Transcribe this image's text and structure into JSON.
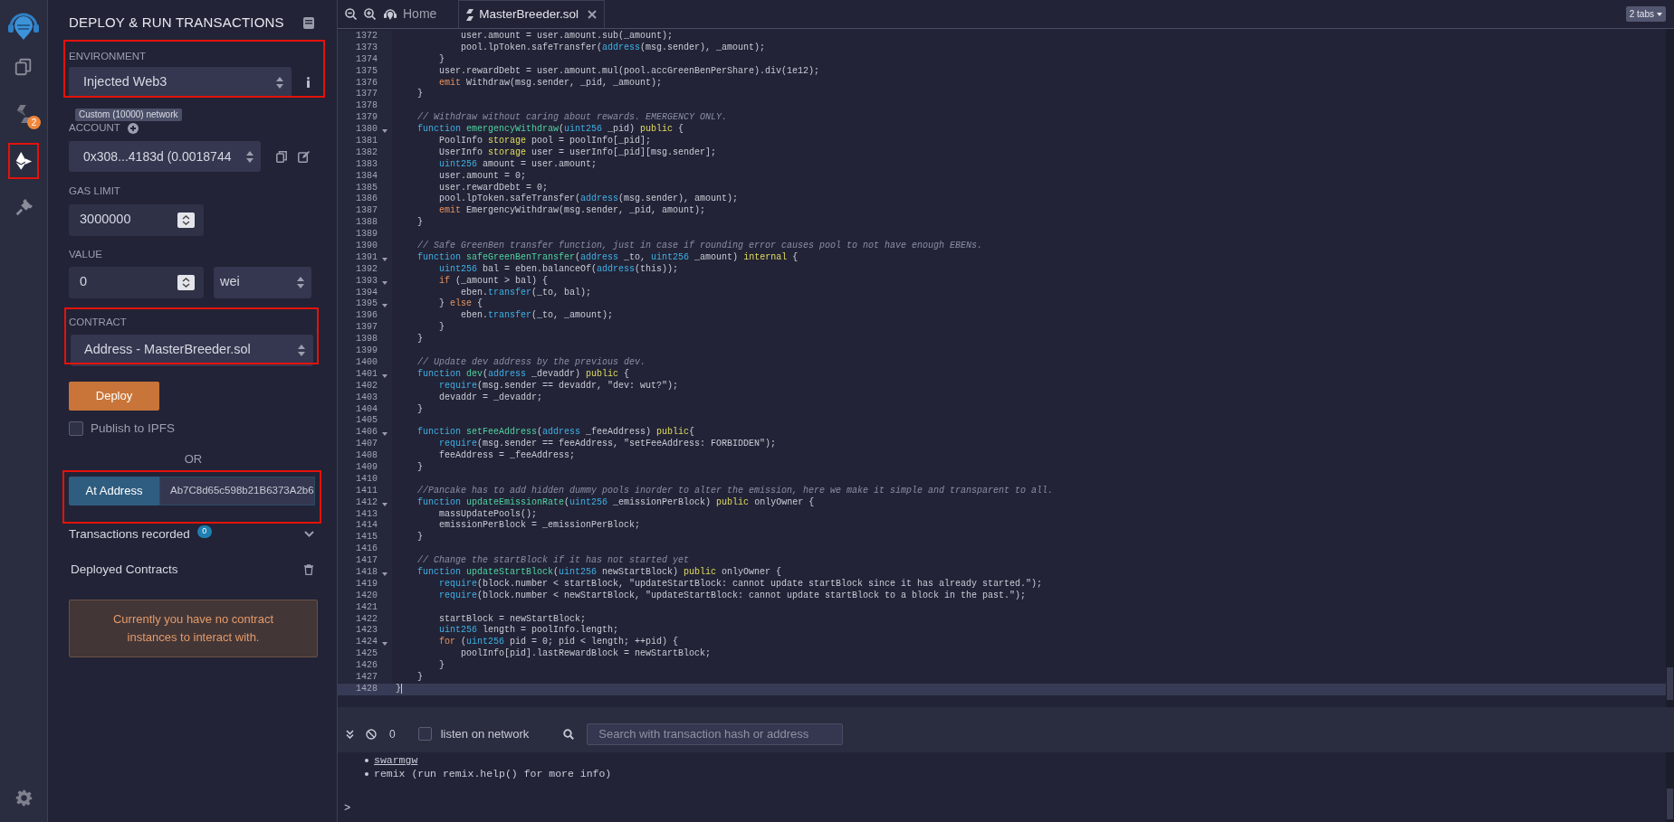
{
  "icon_bar": {
    "items": [
      {
        "kind": "files",
        "selected": false
      },
      {
        "kind": "compiler",
        "selected": false,
        "badge": "2"
      },
      {
        "kind": "deploy",
        "selected": true
      },
      {
        "kind": "plugins",
        "selected": false
      }
    ]
  },
  "panel": {
    "title": "DEPLOY & RUN TRANSACTIONS",
    "environment": {
      "label": "ENVIRONMENT",
      "value": "Injected Web3",
      "tooltip": "Custom (10000) network"
    },
    "account": {
      "label": "ACCOUNT",
      "value": "0x308...4183d (0.0018744"
    },
    "gas_limit": {
      "label": "GAS LIMIT",
      "value": "3000000"
    },
    "value": {
      "label": "VALUE",
      "value": "0",
      "unit": "wei"
    },
    "contract": {
      "label": "CONTRACT",
      "value": "Address - MasterBreeder.sol"
    },
    "deploy_button": "Deploy",
    "publish": {
      "label": "Publish to IPFS",
      "checked": false
    },
    "or": "OR",
    "at_address": {
      "button": "At Address",
      "value": "Ab7C8d65c598b21B6373A2b6"
    },
    "transactions": {
      "label": "Transactions recorded",
      "count": "0"
    },
    "deployed": {
      "label": "Deployed Contracts"
    },
    "message": "Currently you have no contract instances to interact with."
  },
  "editor": {
    "tabs": [
      {
        "kind": "home",
        "label": "Home",
        "selected": false
      },
      {
        "kind": "file",
        "label": "MasterBreeder.sol",
        "selected": true
      }
    ],
    "tabs_menu": "2 tabs",
    "lines": [
      {
        "n": "1372",
        "foldable": false,
        "active": false,
        "t": [
          {
            "kind": "p",
            "text": "            user.amount = user.amount.sub(_amount);"
          }
        ]
      },
      {
        "n": "1373",
        "foldable": false,
        "active": false,
        "t": [
          {
            "kind": "p",
            "text": "            pool.lpToken.safeTransfer("
          },
          {
            "kind": "kw",
            "text": "address"
          },
          {
            "kind": "p",
            "text": "(msg.sender), _amount);"
          }
        ]
      },
      {
        "n": "1374",
        "foldable": false,
        "active": false,
        "t": [
          {
            "kind": "p",
            "text": "        }"
          }
        ]
      },
      {
        "n": "1375",
        "foldable": false,
        "active": false,
        "t": [
          {
            "kind": "p",
            "text": "        user.rewardDebt = user.amount.mul(pool.accGreenBenPerShare).div(1e12);"
          }
        ]
      },
      {
        "n": "1376",
        "foldable": false,
        "active": false,
        "t": [
          {
            "kind": "ctl",
            "text": "        emit"
          },
          {
            "kind": "p",
            "text": " Withdraw(msg.sender, _pid, _amount);"
          }
        ]
      },
      {
        "n": "1377",
        "foldable": false,
        "active": false,
        "t": [
          {
            "kind": "p",
            "text": "    }"
          }
        ]
      },
      {
        "n": "1378",
        "foldable": false,
        "active": false
      },
      {
        "n": "1379",
        "foldable": false,
        "active": false,
        "t": [
          {
            "kind": "c",
            "text": "    // Withdraw without caring about rewards. EMERGENCY ONLY."
          }
        ]
      },
      {
        "n": "1380",
        "foldable": true,
        "active": false,
        "t": [
          {
            "kind": "kw",
            "text": "    function "
          },
          {
            "kind": "fn",
            "text": "emergencyWithdraw"
          },
          {
            "kind": "p",
            "text": "("
          },
          {
            "kind": "kw",
            "text": "uint256"
          },
          {
            "kind": "p",
            "text": " _pid) "
          },
          {
            "kind": "mod",
            "text": "public"
          },
          {
            "kind": "p",
            "text": " {"
          }
        ]
      },
      {
        "n": "1381",
        "foldable": false,
        "active": false,
        "t": [
          {
            "kind": "p",
            "text": "        PoolInfo "
          },
          {
            "kind": "mod",
            "text": "storage"
          },
          {
            "kind": "p",
            "text": " pool = poolInfo[_pid];"
          }
        ]
      },
      {
        "n": "1382",
        "foldable": false,
        "active": false,
        "t": [
          {
            "kind": "p",
            "text": "        UserInfo "
          },
          {
            "kind": "mod",
            "text": "storage"
          },
          {
            "kind": "p",
            "text": " user = userInfo[_pid][msg.sender];"
          }
        ]
      },
      {
        "n": "1383",
        "foldable": false,
        "active": false,
        "t": [
          {
            "kind": "kw",
            "text": "        uint256"
          },
          {
            "kind": "p",
            "text": " amount = user.amount;"
          }
        ]
      },
      {
        "n": "1384",
        "foldable": false,
        "active": false,
        "t": [
          {
            "kind": "p",
            "text": "        user.amount = 0;"
          }
        ]
      },
      {
        "n": "1385",
        "foldable": false,
        "active": false,
        "t": [
          {
            "kind": "p",
            "text": "        user.rewardDebt = 0;"
          }
        ]
      },
      {
        "n": "1386",
        "foldable": false,
        "active": false,
        "t": [
          {
            "kind": "p",
            "text": "        pool.lpToken.safeTransfer("
          },
          {
            "kind": "kw",
            "text": "address"
          },
          {
            "kind": "p",
            "text": "(msg.sender), amount);"
          }
        ]
      },
      {
        "n": "1387",
        "foldable": false,
        "active": false,
        "t": [
          {
            "kind": "ctl",
            "text": "        emit"
          },
          {
            "kind": "p",
            "text": " EmergencyWithdraw(msg.sender, _pid, amount);"
          }
        ]
      },
      {
        "n": "1388",
        "foldable": false,
        "active": false,
        "t": [
          {
            "kind": "p",
            "text": "    }"
          }
        ]
      },
      {
        "n": "1389",
        "foldable": false,
        "active": false
      },
      {
        "n": "1390",
        "foldable": false,
        "active": false,
        "t": [
          {
            "kind": "c",
            "text": "    // Safe GreenBen transfer function, just in case if rounding error causes pool to not have enough EBENs."
          }
        ]
      },
      {
        "n": "1391",
        "foldable": true,
        "active": false,
        "t": [
          {
            "kind": "kw",
            "text": "    function "
          },
          {
            "kind": "fn",
            "text": "safeGreenBenTransfer"
          },
          {
            "kind": "p",
            "text": "("
          },
          {
            "kind": "kw",
            "text": "address"
          },
          {
            "kind": "p",
            "text": " _to, "
          },
          {
            "kind": "kw",
            "text": "uint256"
          },
          {
            "kind": "p",
            "text": " _amount) "
          },
          {
            "kind": "mod",
            "text": "internal"
          },
          {
            "kind": "p",
            "text": " {"
          }
        ]
      },
      {
        "n": "1392",
        "foldable": false,
        "active": false,
        "t": [
          {
            "kind": "kw",
            "text": "        uint256"
          },
          {
            "kind": "p",
            "text": " bal = eben.balanceOf("
          },
          {
            "kind": "kw",
            "text": "address"
          },
          {
            "kind": "p",
            "text": "(this));"
          }
        ]
      },
      {
        "n": "1393",
        "foldable": true,
        "active": false,
        "t": [
          {
            "kind": "ctl",
            "text": "        if"
          },
          {
            "kind": "p",
            "text": " (_amount > bal) {"
          }
        ]
      },
      {
        "n": "1394",
        "foldable": false,
        "active": false,
        "t": [
          {
            "kind": "p",
            "text": "            eben."
          },
          {
            "kind": "kw",
            "text": "transfer"
          },
          {
            "kind": "p",
            "text": "(_to, bal);"
          }
        ]
      },
      {
        "n": "1395",
        "foldable": true,
        "active": false,
        "t": [
          {
            "kind": "p",
            "text": "        } "
          },
          {
            "kind": "ctl",
            "text": "else"
          },
          {
            "kind": "p",
            "text": " {"
          }
        ]
      },
      {
        "n": "1396",
        "foldable": false,
        "active": false,
        "t": [
          {
            "kind": "p",
            "text": "            eben."
          },
          {
            "kind": "kw",
            "text": "transfer"
          },
          {
            "kind": "p",
            "text": "(_to, _amount);"
          }
        ]
      },
      {
        "n": "1397",
        "foldable": false,
        "active": false,
        "t": [
          {
            "kind": "p",
            "text": "        }"
          }
        ]
      },
      {
        "n": "1398",
        "foldable": false,
        "active": false,
        "t": [
          {
            "kind": "p",
            "text": "    }"
          }
        ]
      },
      {
        "n": "1399",
        "foldable": false,
        "active": false
      },
      {
        "n": "1400",
        "foldable": false,
        "active": false,
        "t": [
          {
            "kind": "c",
            "text": "    // Update dev address by the previous dev."
          }
        ]
      },
      {
        "n": "1401",
        "foldable": true,
        "active": false,
        "t": [
          {
            "kind": "kw",
            "text": "    function "
          },
          {
            "kind": "fn",
            "text": "dev"
          },
          {
            "kind": "p",
            "text": "("
          },
          {
            "kind": "kw",
            "text": "address"
          },
          {
            "kind": "p",
            "text": " _devaddr) "
          },
          {
            "kind": "mod",
            "text": "public"
          },
          {
            "kind": "p",
            "text": " {"
          }
        ]
      },
      {
        "n": "1402",
        "foldable": false,
        "active": false,
        "t": [
          {
            "kind": "kw",
            "text": "        require"
          },
          {
            "kind": "p",
            "text": "(msg.sender == devaddr, \"dev: wut?\");"
          }
        ]
      },
      {
        "n": "1403",
        "foldable": false,
        "active": false,
        "t": [
          {
            "kind": "p",
            "text": "        devaddr = _devaddr;"
          }
        ]
      },
      {
        "n": "1404",
        "foldable": false,
        "active": false,
        "t": [
          {
            "kind": "p",
            "text": "    }"
          }
        ]
      },
      {
        "n": "1405",
        "foldable": false,
        "active": false
      },
      {
        "n": "1406",
        "foldable": true,
        "active": false,
        "t": [
          {
            "kind": "kw",
            "text": "    function "
          },
          {
            "kind": "fn",
            "text": "setFeeAddress"
          },
          {
            "kind": "p",
            "text": "("
          },
          {
            "kind": "kw",
            "text": "address"
          },
          {
            "kind": "p",
            "text": " _feeAddress) "
          },
          {
            "kind": "mod",
            "text": "public"
          },
          {
            "kind": "p",
            "text": "{"
          }
        ]
      },
      {
        "n": "1407",
        "foldable": false,
        "active": false,
        "t": [
          {
            "kind": "kw",
            "text": "        require"
          },
          {
            "kind": "p",
            "text": "(msg.sender == feeAddress, \"setFeeAddress: FORBIDDEN\");"
          }
        ]
      },
      {
        "n": "1408",
        "foldable": false,
        "active": false,
        "t": [
          {
            "kind": "p",
            "text": "        feeAddress = _feeAddress;"
          }
        ]
      },
      {
        "n": "1409",
        "foldable": false,
        "active": false,
        "t": [
          {
            "kind": "p",
            "text": "    }"
          }
        ]
      },
      {
        "n": "1410",
        "foldable": false,
        "active": false
      },
      {
        "n": "1411",
        "foldable": false,
        "active": false,
        "t": [
          {
            "kind": "c",
            "text": "    //Pancake has to add hidden dummy pools inorder to alter the emission, here we make it simple and transparent to all."
          }
        ]
      },
      {
        "n": "1412",
        "foldable": true,
        "active": false,
        "t": [
          {
            "kind": "kw",
            "text": "    function "
          },
          {
            "kind": "fn",
            "text": "updateEmissionRate"
          },
          {
            "kind": "p",
            "text": "("
          },
          {
            "kind": "kw",
            "text": "uint256"
          },
          {
            "kind": "p",
            "text": " _emissionPerBlock) "
          },
          {
            "kind": "mod",
            "text": "public"
          },
          {
            "kind": "p",
            "text": " onlyOwner {"
          }
        ]
      },
      {
        "n": "1413",
        "foldable": false,
        "active": false,
        "t": [
          {
            "kind": "p",
            "text": "        massUpdatePools();"
          }
        ]
      },
      {
        "n": "1414",
        "foldable": false,
        "active": false,
        "t": [
          {
            "kind": "p",
            "text": "        emissionPerBlock = _emissionPerBlock;"
          }
        ]
      },
      {
        "n": "1415",
        "foldable": false,
        "active": false,
        "t": [
          {
            "kind": "p",
            "text": "    }"
          }
        ]
      },
      {
        "n": "1416",
        "foldable": false,
        "active": false
      },
      {
        "n": "1417",
        "foldable": false,
        "active": false,
        "t": [
          {
            "kind": "c",
            "text": "    // Change the startBlock if it has not started yet"
          }
        ]
      },
      {
        "n": "1418",
        "foldable": true,
        "active": false,
        "t": [
          {
            "kind": "kw",
            "text": "    function "
          },
          {
            "kind": "fn",
            "text": "updateStartBlock"
          },
          {
            "kind": "p",
            "text": "("
          },
          {
            "kind": "kw",
            "text": "uint256"
          },
          {
            "kind": "p",
            "text": " newStartBlock) "
          },
          {
            "kind": "mod",
            "text": "public"
          },
          {
            "kind": "p",
            "text": " onlyOwner {"
          }
        ]
      },
      {
        "n": "1419",
        "foldable": false,
        "active": false,
        "t": [
          {
            "kind": "kw",
            "text": "        require"
          },
          {
            "kind": "p",
            "text": "(block.number < startBlock, \"updateStartBlock: cannot update startBlock since it has already started.\");"
          }
        ]
      },
      {
        "n": "1420",
        "foldable": false,
        "active": false,
        "t": [
          {
            "kind": "kw",
            "text": "        require"
          },
          {
            "kind": "p",
            "text": "(block.number < newStartBlock, \"updateStartBlock: cannot update startBlock to a block in the past.\");"
          }
        ]
      },
      {
        "n": "1421",
        "foldable": false,
        "active": false
      },
      {
        "n": "1422",
        "foldable": false,
        "active": false,
        "t": [
          {
            "kind": "p",
            "text": "        startBlock = newStartBlock;"
          }
        ]
      },
      {
        "n": "1423",
        "foldable": false,
        "active": false,
        "t": [
          {
            "kind": "kw",
            "text": "        uint256"
          },
          {
            "kind": "p",
            "text": " length = poolInfo.length;"
          }
        ]
      },
      {
        "n": "1424",
        "foldable": true,
        "active": false,
        "t": [
          {
            "kind": "ctl",
            "text": "        for"
          },
          {
            "kind": "p",
            "text": " ("
          },
          {
            "kind": "kw",
            "text": "uint256"
          },
          {
            "kind": "p",
            "text": " pid = 0; pid < length; ++pid) {"
          }
        ]
      },
      {
        "n": "1425",
        "foldable": false,
        "active": false,
        "t": [
          {
            "kind": "p",
            "text": "            poolInfo[pid].lastRewardBlock = newStartBlock;"
          }
        ]
      },
      {
        "n": "1426",
        "foldable": false,
        "active": false,
        "t": [
          {
            "kind": "p",
            "text": "        }"
          }
        ]
      },
      {
        "n": "1427",
        "foldable": false,
        "active": false,
        "t": [
          {
            "kind": "p",
            "text": "    }"
          }
        ]
      },
      {
        "n": "1428",
        "foldable": false,
        "active": true,
        "t": [
          {
            "kind": "p",
            "text": "}"
          }
        ]
      }
    ]
  },
  "terminal": {
    "count": "0",
    "listen": {
      "label": "listen on network",
      "checked": false
    },
    "search_placeholder": "Search with transaction hash or address",
    "output": [
      {
        "kind": "link",
        "text": "swarmgw"
      },
      {
        "kind": "plain",
        "text": "remix (run remix.help() for more info)"
      }
    ],
    "prompt": ">"
  }
}
